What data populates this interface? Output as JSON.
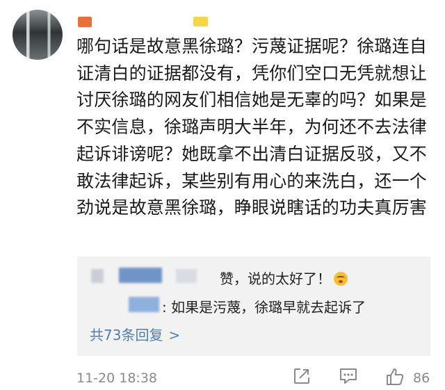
{
  "comment": {
    "text": "哪句话是故意黑徐璐？污蔑证据呢？徐璐连自证清白的证据都没有，凭你们空口无凭就想让讨厌徐璐的网友们相信她是无辜的吗？如果是不实信息，徐璐声明大半年，为何还不去法律起诉诽谤呢？她既拿不出清白证据反驳，又不敢法律起诉，某些别有用心的来洗白，还一个劲说是故意黑徐璐，睁眼说瞎话的功夫真厉害"
  },
  "replies": [
    {
      "text": "赞，说的太好了！",
      "emoji": "blush-emoji"
    },
    {
      "text": ": 如果是污蔑，徐璐早就去起诉了"
    }
  ],
  "more_replies": {
    "label": "共73条回复",
    "chevron": ">"
  },
  "meta": {
    "time": "11-20 18:38",
    "like_count": "86"
  },
  "colors": {
    "link": "#507daf",
    "reply_bg": "#f2f2f2",
    "meta_gray": "#8a8a8a"
  },
  "icons": [
    "share-icon",
    "comment-icon",
    "like-icon"
  ]
}
